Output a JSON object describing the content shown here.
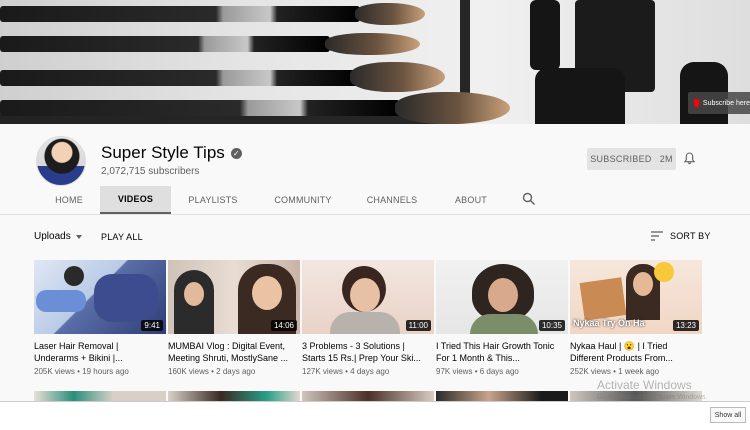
{
  "banner": {
    "subscribe_label": "Subscribe here"
  },
  "channel": {
    "name": "Super Style Tips",
    "subscribers": "2,072,715 subscribers",
    "subscribed_label": "SUBSCRIBED",
    "subscribed_count": "2M"
  },
  "tabs": [
    {
      "label": "HOME",
      "active": false
    },
    {
      "label": "VIDEOS",
      "active": true
    },
    {
      "label": "PLAYLISTS",
      "active": false
    },
    {
      "label": "COMMUNITY",
      "active": false
    },
    {
      "label": "CHANNELS",
      "active": false
    },
    {
      "label": "ABOUT",
      "active": false
    }
  ],
  "toolbar": {
    "uploads_label": "Uploads",
    "play_all_label": "PLAY ALL",
    "sort_by_label": "SORT BY"
  },
  "videos": [
    {
      "title_line1": "Laser Hair Removal |",
      "title_line2": "Underarms + Bikini |...",
      "views": "205K views",
      "age": "19 hours ago",
      "duration": "9:41"
    },
    {
      "title_line1": "MUMBAI Vlog : Digital Event,",
      "title_line2": "Meeting Shruti, MostlySane ...",
      "views": "160K views",
      "age": "2 days ago",
      "duration": "14:06"
    },
    {
      "title_line1": "3 Problems - 3 Solutions |",
      "title_line2": "Starts 15 Rs.| Prep Your Ski...",
      "views": "127K views",
      "age": "4 days ago",
      "duration": "11:00"
    },
    {
      "title_line1": "I Tried This Hair Growth Tonic",
      "title_line2": "For 1 Month & This...",
      "views": "97K views",
      "age": "6 days ago",
      "duration": "10:35"
    },
    {
      "title_line1": "Nykaa Haul | 😮 | I Tried",
      "title_line2": "Different Products From...",
      "views": "252K views",
      "age": "1 week ago",
      "duration": "13:23",
      "thumb_text": "Nykaa Try On Ha"
    }
  ],
  "overlay": {
    "activate_windows": "Activate Windows",
    "activate_sub": "Go to Settings to activate Windows.",
    "show_all": "Show all"
  },
  "colors": {
    "background": "#f9f9f9",
    "text_secondary": "#606060",
    "subscribed_bg": "#e3e3e3",
    "youtube_red": "#ff0000"
  }
}
